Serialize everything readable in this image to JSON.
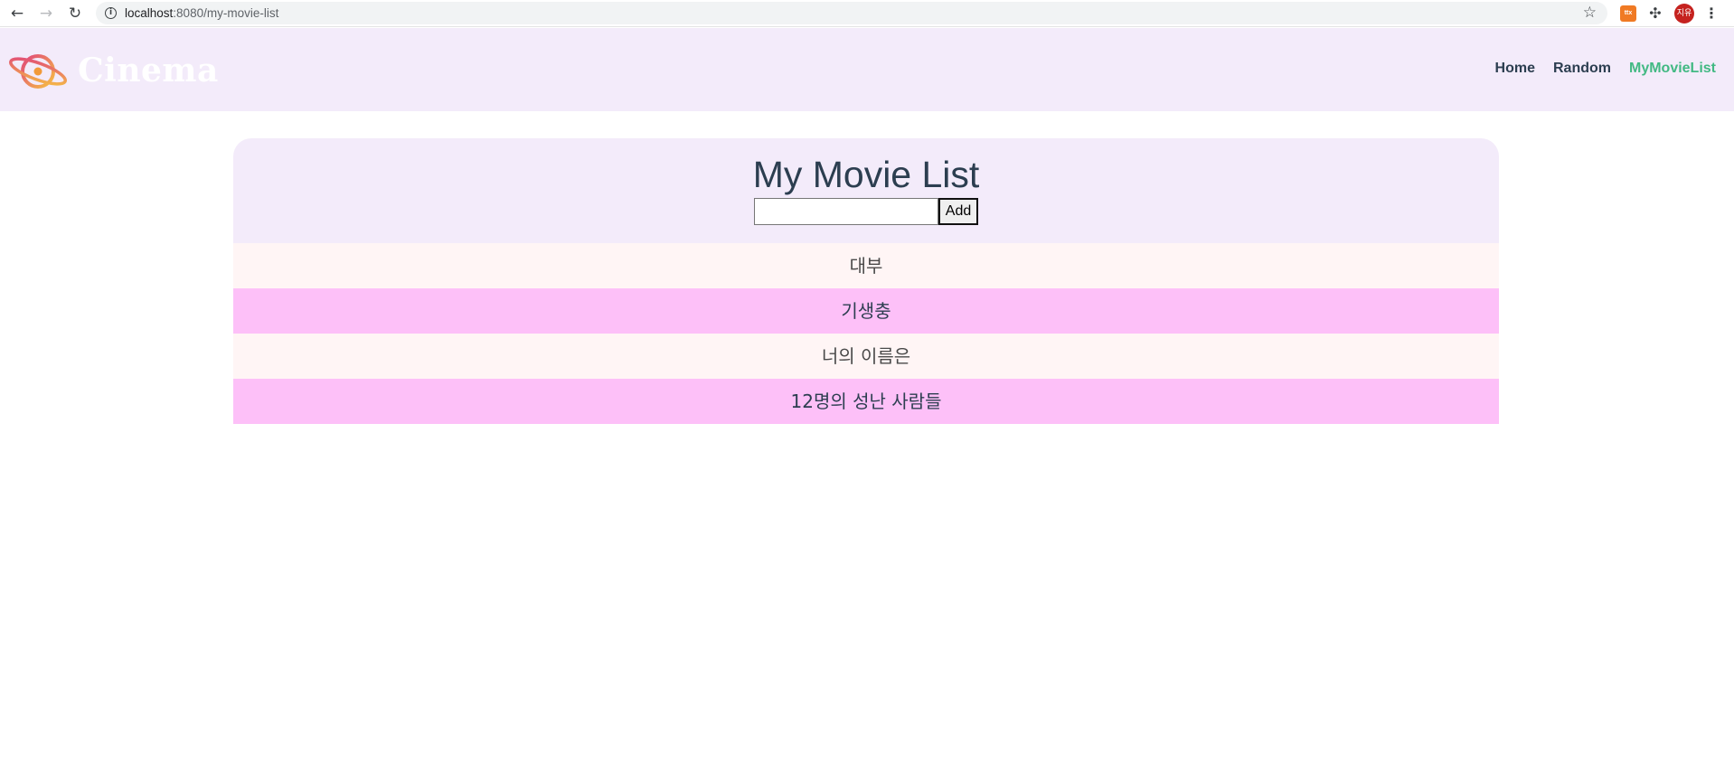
{
  "browser": {
    "url_host": "localhost",
    "url_rest": ":8080/my-movie-list",
    "ext_label": "ttx",
    "profile_label": "지유"
  },
  "header": {
    "brand": "Cinema",
    "nav": [
      {
        "label": "Home",
        "active": false
      },
      {
        "label": "Random",
        "active": false
      },
      {
        "label": "MyMovieList",
        "active": true
      }
    ]
  },
  "main": {
    "title": "My Movie List",
    "input_value": "",
    "add_label": "Add",
    "movies": [
      "대부",
      "기생충",
      "너의 이름은",
      "12명의 성난 사람들"
    ]
  },
  "colors": {
    "header_bg": "#f3ebfa",
    "nav_active": "#42b983",
    "row_light": "#fff5f5",
    "row_pink": "#fdc0f8"
  }
}
